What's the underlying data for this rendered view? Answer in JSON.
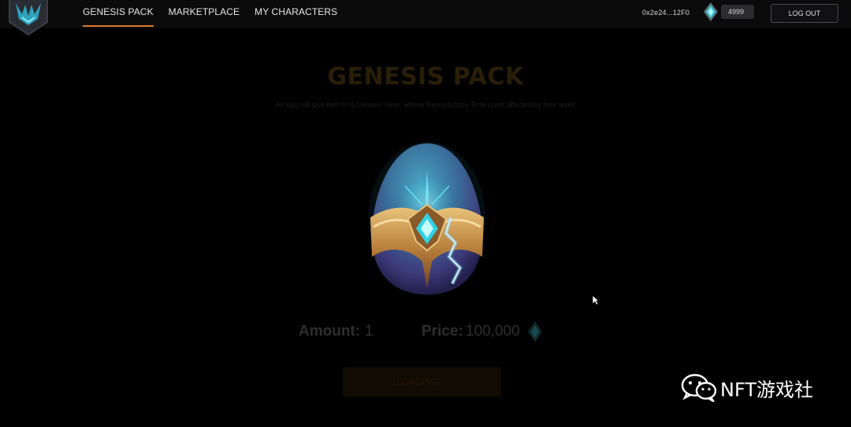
{
  "nav": {
    "items": [
      {
        "label": "GENESIS PACK",
        "active": true
      },
      {
        "label": "MARKETPLACE",
        "active": false
      },
      {
        "label": "MY CHARACTERS",
        "active": false
      }
    ]
  },
  "header": {
    "wallet_address": "0x2e24...12F0",
    "gem_balance": "4999",
    "logout_label": "LOG OUT"
  },
  "main": {
    "title": "GENESIS PACK",
    "subtitle": "An egg will give birth to a Genesis Hero, whose Reproduction Time is not affected by their level!",
    "amount_label": "Amount:",
    "amount_value": "1",
    "price_label": "Price:",
    "price_value": "100,000",
    "button_label": "LOADING..."
  },
  "watermark": {
    "text": "NFT游戏社"
  },
  "colors": {
    "accent": "#d97a2a",
    "background": "#000000",
    "gem": "#3fd3e0"
  },
  "icons": [
    "logo-icon",
    "gem-icon",
    "egg-image",
    "mouse-cursor-icon",
    "wechat-icon"
  ]
}
